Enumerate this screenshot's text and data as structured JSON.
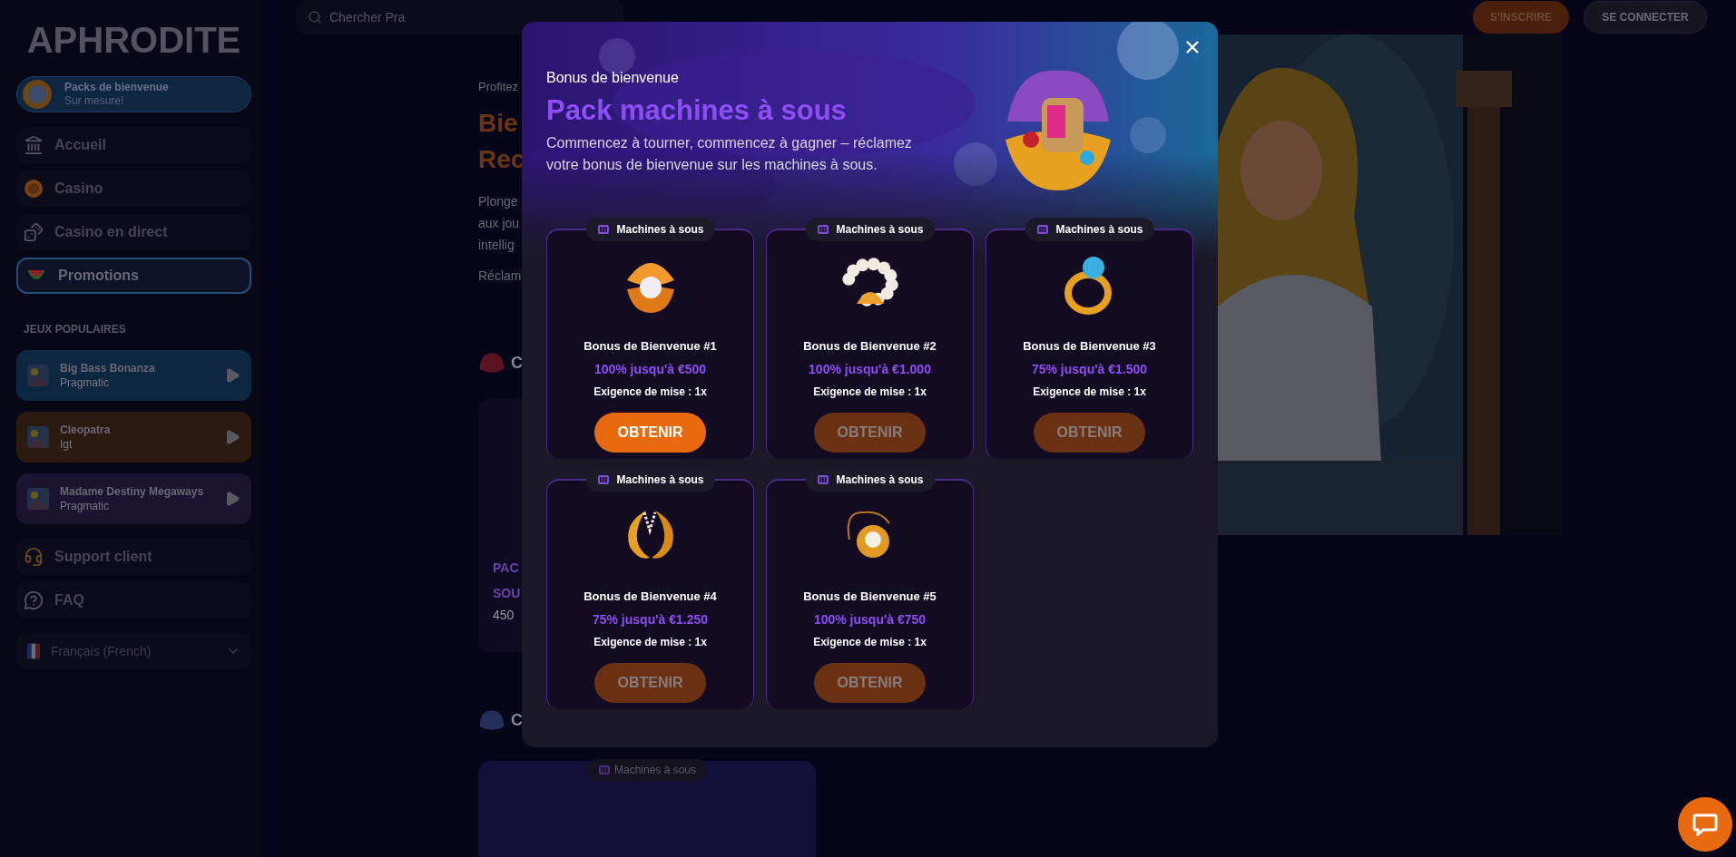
{
  "sidebar": {
    "logo": "APHRODITE",
    "promo_banner": {
      "title": "Packs de bienvenue",
      "subtitle": "Sur mesure!"
    },
    "nav": [
      {
        "label": "Accueil",
        "selected": false
      },
      {
        "label": "Casino",
        "selected": false
      },
      {
        "label": "Casino en direct",
        "selected": false
      },
      {
        "label": "Promotions",
        "selected": true
      }
    ],
    "popular_title": "JEUX POPULAIRES",
    "games": [
      {
        "name": "Big Bass Bonanza",
        "provider": "Pragmatic",
        "color": "#0d2740"
      },
      {
        "name": "Cleopatra",
        "provider": "Igt",
        "color": "#2a1a10"
      },
      {
        "name": "Madame Destiny Megaways",
        "provider": "Pragmatic",
        "color": "#1a1430"
      }
    ],
    "bottom_nav": [
      {
        "label": "Support client"
      },
      {
        "label": "FAQ"
      }
    ],
    "language": "Français (French)"
  },
  "header": {
    "search": {
      "placeholder": "Chercher Pra"
    },
    "buttons": [
      {
        "label": "S'INSCRIRE",
        "kind": "primary"
      },
      {
        "label": "SE CONNECTER",
        "kind": "secondary"
      }
    ]
  },
  "page": {
    "eyebrow": "Profitez",
    "title_lines": [
      "Bie",
      "Rec"
    ],
    "paragraph_lines": [
      "Plonge",
      "aux jou",
      "intellig"
    ],
    "claim": "Réclam",
    "sections": [
      {
        "heading": "C",
        "card": {
          "lines": [
            "PAC",
            "SOU"
          ],
          "amount": "450"
        }
      },
      {
        "heading": "C",
        "card": {
          "badge": "Machines à sous"
        }
      }
    ]
  },
  "modal": {
    "eyebrow": "Bonus de bienvenue",
    "title": "Pack machines à sous",
    "description": "Commencez à tourner, commencez à gagner – réclamez votre bonus de bienvenue sur les machines à sous.",
    "bonuses": [
      {
        "badge": "Machines à sous",
        "title": "Bonus de Bienvenue #1",
        "offer": "100% jusqu'à €500",
        "wagering": "Exigence de mise : 1x",
        "button": "OBTENIR",
        "disabled": false
      },
      {
        "badge": "Machines à sous",
        "title": "Bonus de Bienvenue #2",
        "offer": "100% jusqu'à €1.000",
        "wagering": "Exigence de mise : 1x",
        "button": "OBTENIR",
        "disabled": true
      },
      {
        "badge": "Machines à sous",
        "title": "Bonus de Bienvenue #3",
        "offer": "75% jusqu'à €1.500",
        "wagering": "Exigence de mise : 1x",
        "button": "OBTENIR",
        "disabled": true
      },
      {
        "badge": "Machines à sous",
        "title": "Bonus de Bienvenue #4",
        "offer": "75% jusqu'à €1.250",
        "wagering": "Exigence de mise : 1x",
        "button": "OBTENIR",
        "disabled": true
      },
      {
        "badge": "Machines à sous",
        "title": "Bonus de Bienvenue #5",
        "offer": "100% jusqu'à €750",
        "wagering": "Exigence de mise : 1x",
        "button": "OBTENIR",
        "disabled": true
      }
    ]
  }
}
